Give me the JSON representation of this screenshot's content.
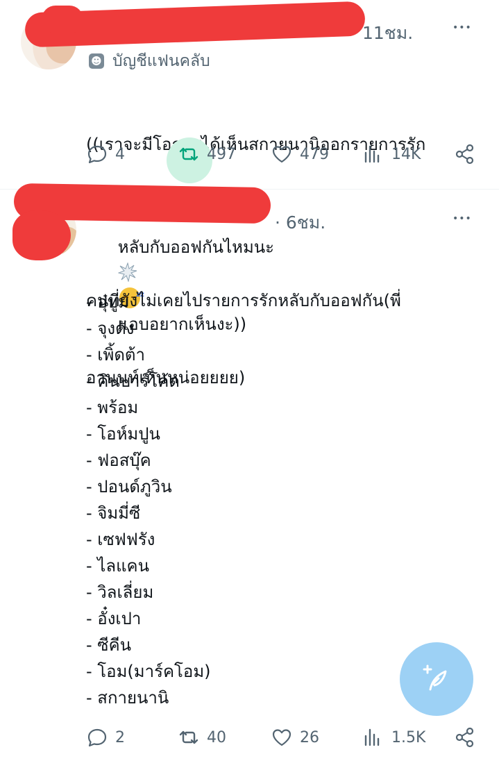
{
  "posts": [
    {
      "time": "11ชม.",
      "fan_label": "บัญชีแฟนคลับ",
      "text_line1": "((เราจะมีโอกาสได้เห็นสกายนานิออกรายการรัก",
      "text_line2_a": "หลับกับออฟกันไหมนะ",
      "text_line2_b": "แอบอยากเห็นงะ))",
      "replies": "4",
      "reposts": "497",
      "likes": "479",
      "views": "14K",
      "more": "•••"
    },
    {
      "time": "· 6ชม.",
      "text_line1": "คนที่ยังไม่เคยไปรายการรักหลับกับออฟกัน(พี่",
      "text_line2": "อานนท์เห็นหน่อยยยย)",
      "list": [
        "- อุ๋บูม",
        "- จุงดัง",
        "- เพิ้ดต้า",
        "- คินบาร์โค้ด",
        "- พร้อม",
        "- โอห์มปูน",
        "- ฟอสบุ๊ค",
        "- ปอนด์ภูวิน",
        "- จิมมี่ซี",
        "- เซฟฟรัง",
        "- ไลแคน",
        "- วิลเลี่ยม",
        "- อั๋งเปา",
        "- ซีคีน",
        "- โอม(มาร์คโอม)",
        "- สกายนานิ"
      ],
      "replies": "2",
      "reposts": "40",
      "likes": "26",
      "views": "1.5K",
      "more": "•••"
    }
  ],
  "colors": {
    "accent_repost": "#cdf2e2",
    "muted": "#536471",
    "fab": "#9dd1f5",
    "redaction": "#ef3b3b"
  },
  "icons": [
    "reply-icon",
    "repost-icon",
    "like-icon",
    "views-icon",
    "share-icon",
    "compose-icon",
    "fan-club-icon"
  ]
}
